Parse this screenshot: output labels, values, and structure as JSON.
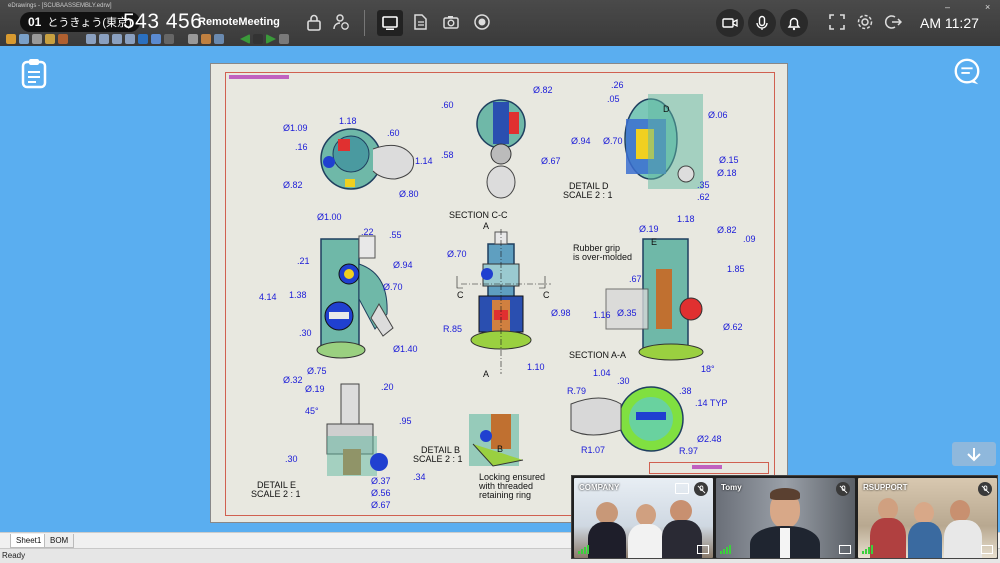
{
  "window": {
    "app_title": "eDrawings - [SCUBAASSEMBLY.edrw]",
    "room_number": "01",
    "room_name": "とうきょう(東京)",
    "meeting_id": "543 456",
    "meeting_name": "RemoteMeeting",
    "clock": "AM 11:27",
    "minimize": "–",
    "close": "×"
  },
  "drawing": {
    "labels": {
      "section_cc": "SECTION C-C",
      "section_aa": "SECTION A-A",
      "detail_d": "DETAIL D",
      "detail_d_scale": "SCALE 2 : 1",
      "detail_b": "DETAIL B",
      "detail_b_scale": "SCALE 2 : 1",
      "detail_e": "DETAIL E",
      "detail_e_scale": "SCALE 2 : 1",
      "rubber_grip_1": "Rubber grip",
      "rubber_grip_2": "is over-molded",
      "locking_1": "Locking ensured",
      "locking_2": "with threaded",
      "locking_3": "retaining ring",
      "a_top": "A",
      "a_bottom": "A",
      "c_left": "C",
      "c_right": "C",
      "e_mark": "E",
      "d_mark": "D",
      "b_mark": "B"
    },
    "dims": {
      "d1": "1.18",
      "d2": "Ø1.09",
      "d3": ".60",
      "d4": ".16",
      "d5": "1.14",
      "d6": "Ø.82",
      "d7": "Ø.80",
      "d8": ".60",
      "d9": "Ø.82",
      "d10": ".58",
      "d11": "Ø.67",
      "d12": ".26",
      "d13": ".05",
      "d14": "Ø.06",
      "d15": "Ø.94",
      "d16": "Ø.70",
      "d17": "Ø.15",
      "d18": "Ø.18",
      "d19": ".35",
      "d20": ".62",
      "d21": "Ø1.00",
      "d22": ".22",
      "d23": ".55",
      "d24": ".21",
      "d25": "Ø.94",
      "d26": "4.14",
      "d27": "1.38",
      "d28": "Ø.70",
      "d29": ".30",
      "d30": "R.85",
      "d31": "Ø1.40",
      "d32": "Ø.70",
      "d33": "Ø.98",
      "d34": "1.10",
      "d35": "1.18",
      "d36": "Ø.19",
      "d37": "Ø.82",
      "d38": ".09",
      "d39": ".67",
      "d40": "1.85",
      "d41": "1.16",
      "d42": "Ø.35",
      "d43": "Ø.62",
      "d44": "18°",
      "d45": "Ø.75",
      "d46": "Ø.32",
      "d47": "Ø.19",
      "d48": ".20",
      "d49": "45°",
      "d50": ".95",
      "d51": ".30",
      "d52": "Ø.56",
      "d53": "Ø.67",
      "d54": ".34",
      "d55": "Ø.37",
      "d56": "1.04",
      "d57": "R.79",
      "d58": ".30",
      "d59": ".38",
      "d60": ".14 TYP",
      "d61": "Ø2.48",
      "d62": "R1.07",
      "d63": "R.97"
    }
  },
  "tabs": [
    {
      "label": "Sheet1"
    },
    {
      "label": "BOM"
    }
  ],
  "status": "Ready",
  "participants": [
    {
      "name": "COMPANY"
    },
    {
      "name": "Tomy"
    },
    {
      "name": "RSUPPORT"
    }
  ],
  "colors": {
    "topbar": "#3f3f3f",
    "canvas": "#5aaef0",
    "dimension": "#1a1ad8",
    "signal": "#3cd03c"
  }
}
